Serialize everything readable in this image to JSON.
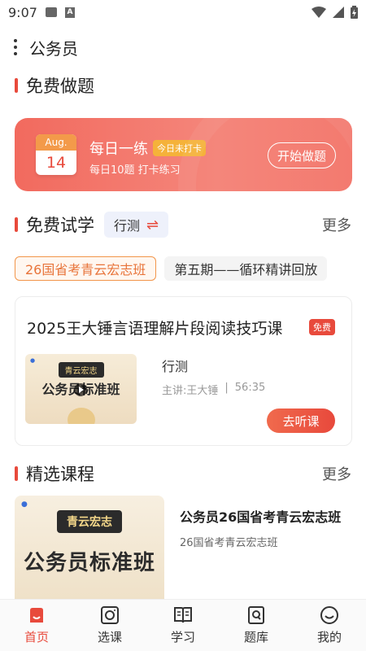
{
  "status": {
    "time": "9:07"
  },
  "header": {
    "title": "公务员"
  },
  "practice_section": {
    "title": "免费做题"
  },
  "practice_card": {
    "month": "Aug.",
    "day": "14",
    "title": "每日一练",
    "badge": "今日未打卡",
    "subtitle": "每日10题 打卡练习",
    "button": "开始做题"
  },
  "trial_section": {
    "title": "免费试学",
    "subject_chip": "行测",
    "more": "更多"
  },
  "tags": [
    {
      "label": "26国省考青云宏志班"
    },
    {
      "label": "第五期——循环精讲回放"
    }
  ],
  "trial_card": {
    "title": "2025王大锤言语理解片段阅读技巧课",
    "badge": "免费",
    "thumb_chip": "青云宏志",
    "thumb_text": "公务员标准班",
    "subject": "行测",
    "lecturer": "主讲:王大锤",
    "separator": "|",
    "duration": "56:35",
    "button": "去听课"
  },
  "featured_section": {
    "title": "精选课程",
    "more": "更多"
  },
  "featured_course": {
    "thumb_chip": "青云宏志",
    "thumb_text": "公务员标准班",
    "title": "公务员26国省考青云宏志班",
    "subtitle": "26国省考青云宏志班"
  },
  "bottom_nav": [
    {
      "label": "首页",
      "icon": "home-icon",
      "active": true
    },
    {
      "label": "选课",
      "icon": "course-select-icon",
      "active": false
    },
    {
      "label": "学习",
      "icon": "book-icon",
      "active": false
    },
    {
      "label": "题库",
      "icon": "question-bank-icon",
      "active": false
    },
    {
      "label": "我的",
      "icon": "profile-icon",
      "active": false
    }
  ],
  "colors": {
    "accent": "#e84a3c",
    "orange": "#f2954a"
  }
}
